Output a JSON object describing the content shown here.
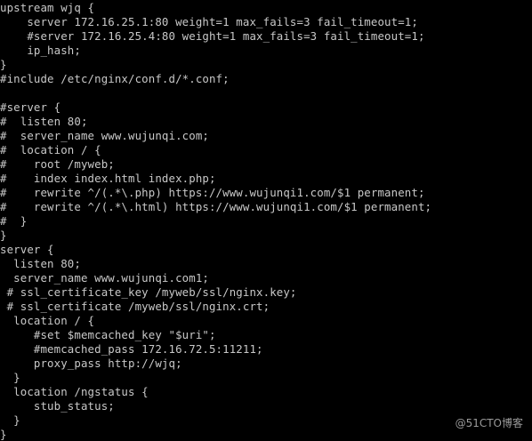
{
  "terminal": {
    "lines": [
      "upstream wjq {",
      "    server 172.16.25.1:80 weight=1 max_fails=3 fail_timeout=1;",
      "    #server 172.16.25.4:80 weight=1 max_fails=3 fail_timeout=1;",
      "    ip_hash;",
      "}",
      "#include /etc/nginx/conf.d/*.conf;",
      "",
      "#server {",
      "#  listen 80;",
      "#  server_name www.wujunqi.com;",
      "#  location / {",
      "#    root /myweb;",
      "#    index index.html index.php;",
      "#    rewrite ^/(.*\\.php) https://www.wujunqi1.com/$1 permanent;",
      "#    rewrite ^/(.*\\.html) https://www.wujunqi1.com/$1 permanent;",
      "#  }",
      "}",
      "server {",
      "  listen 80;",
      "  server_name www.wujunqi.com1;",
      " # ssl_certificate_key /myweb/ssl/nginx.key;",
      " # ssl_certificate /myweb/ssl/nginx.crt;",
      "  location / {",
      "     #set $memcached_key \"$uri\";",
      "     #memcached_pass 172.16.72.5:11211;",
      "     proxy_pass http://wjq;",
      "  }",
      "  location /ngstatus {",
      "     stub_status;",
      "  }",
      "}"
    ]
  },
  "watermark": {
    "text": "@51CTO博客"
  }
}
